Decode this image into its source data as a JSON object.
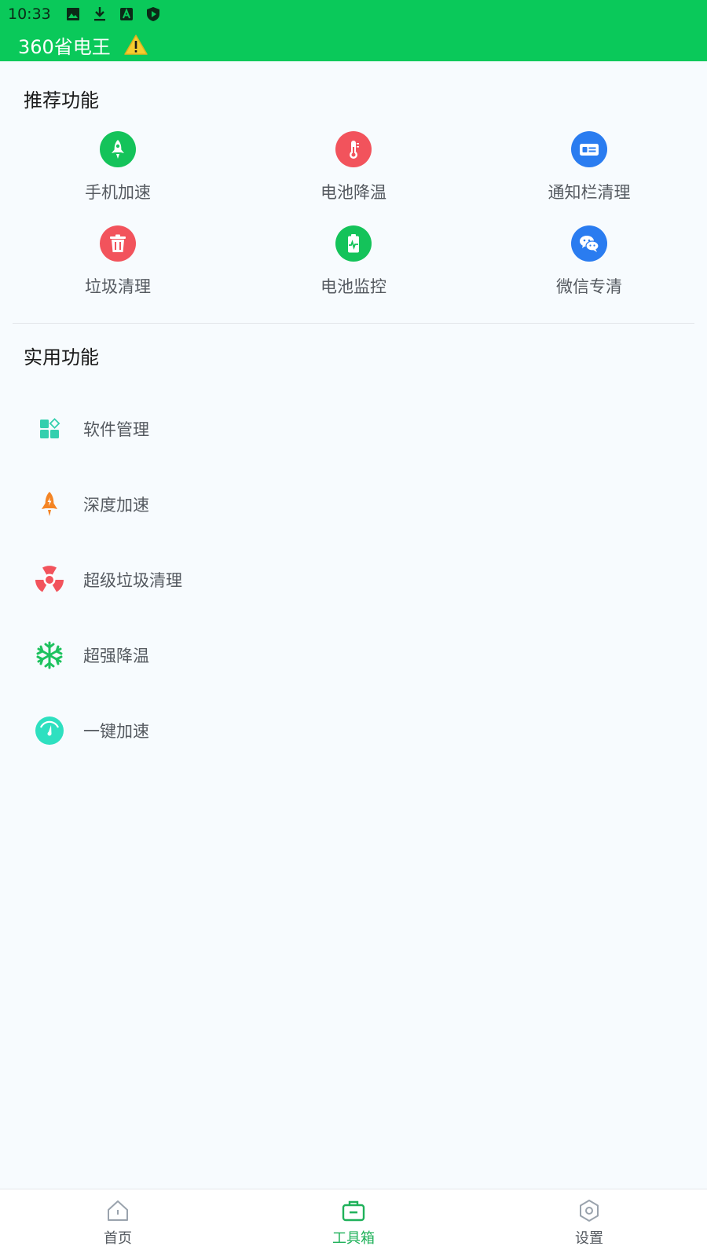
{
  "status_bar": {
    "time": "10:33",
    "icons": [
      "image-icon",
      "download-icon",
      "a-badge-icon",
      "play-shield-icon"
    ]
  },
  "app": {
    "title": "360省电王",
    "warning_icon": "warning-icon"
  },
  "recommended": {
    "title": "推荐功能",
    "items": [
      {
        "label": "手机加速",
        "icon": "rocket-icon",
        "color": "#14c35a"
      },
      {
        "label": "电池降温",
        "icon": "thermometer-icon",
        "color": "#f2535c"
      },
      {
        "label": "通知栏清理",
        "icon": "notification-card-icon",
        "color": "#2a7cf0"
      },
      {
        "label": "垃圾清理",
        "icon": "trash-icon",
        "color": "#f2535c"
      },
      {
        "label": "电池监控",
        "icon": "battery-monitor-icon",
        "color": "#14c35a"
      },
      {
        "label": "微信专清",
        "icon": "wechat-icon",
        "color": "#2a7cf0"
      }
    ]
  },
  "utility": {
    "title": "实用功能",
    "items": [
      {
        "label": "软件管理",
        "icon": "apps-grid-icon",
        "color": "#33cfae"
      },
      {
        "label": "深度加速",
        "icon": "rocket-bolt-icon",
        "color": "#f48424"
      },
      {
        "label": "超级垃圾清理",
        "icon": "radiation-icon",
        "color": "#f2535c"
      },
      {
        "label": "超强降温",
        "icon": "snowflake-icon",
        "color": "#1ec25f"
      },
      {
        "label": "一键加速",
        "icon": "speedometer-icon",
        "color": "#2ee0c0"
      }
    ]
  },
  "bottom_nav": {
    "items": [
      {
        "label": "首页",
        "icon": "home-icon",
        "active": false
      },
      {
        "label": "工具箱",
        "icon": "toolbox-icon",
        "active": true
      },
      {
        "label": "设置",
        "icon": "settings-hex-icon",
        "active": false
      }
    ],
    "active_color": "#1fb15a",
    "inactive_color": "#555a60"
  },
  "colors": {
    "header": "#0ac95a",
    "background": "#f7fbfe"
  }
}
